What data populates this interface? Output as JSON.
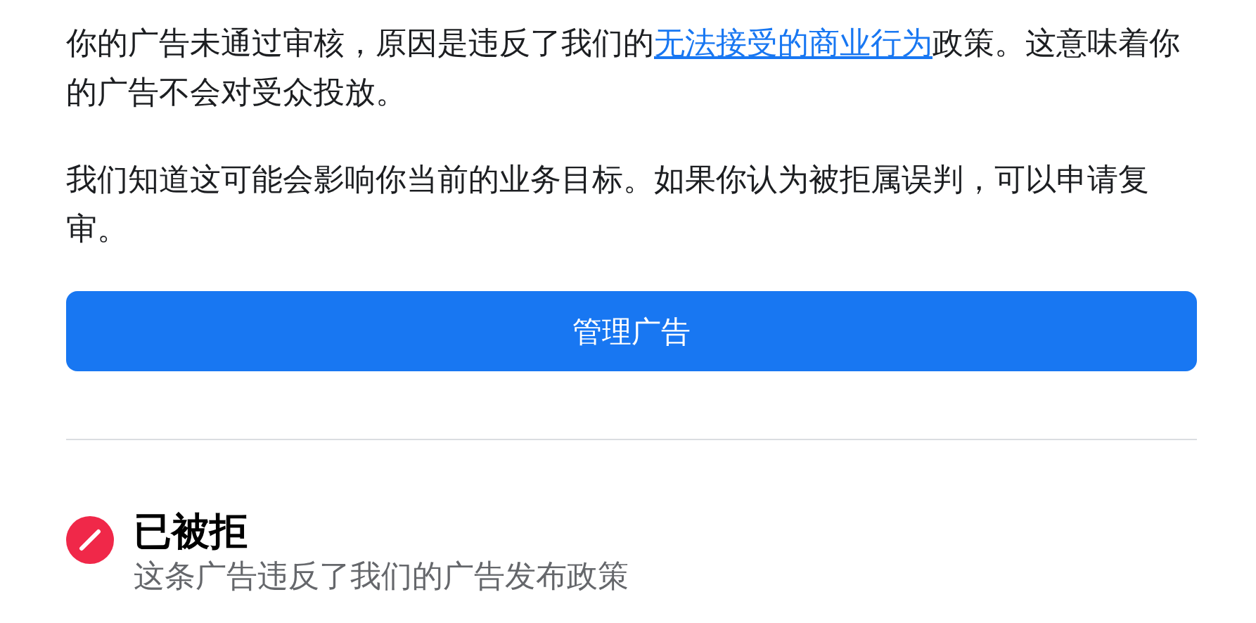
{
  "message": {
    "paragraphs": [
      {
        "before": "你的广告未通过审核，原因是违反了我们的",
        "link": "无法接受的商业行为",
        "after": "政策。这意味着你的广告不会对受众投放。"
      },
      {
        "before": "我们知道这可能会影响你当前的业务目标。如果你认为被拒属误判，可以申请复审。"
      }
    ]
  },
  "primary_button": {
    "label": "管理广告"
  },
  "status": {
    "kind": "rejected",
    "title": "已被拒",
    "description": "这条广告违反了我们的广告发布政策"
  }
}
